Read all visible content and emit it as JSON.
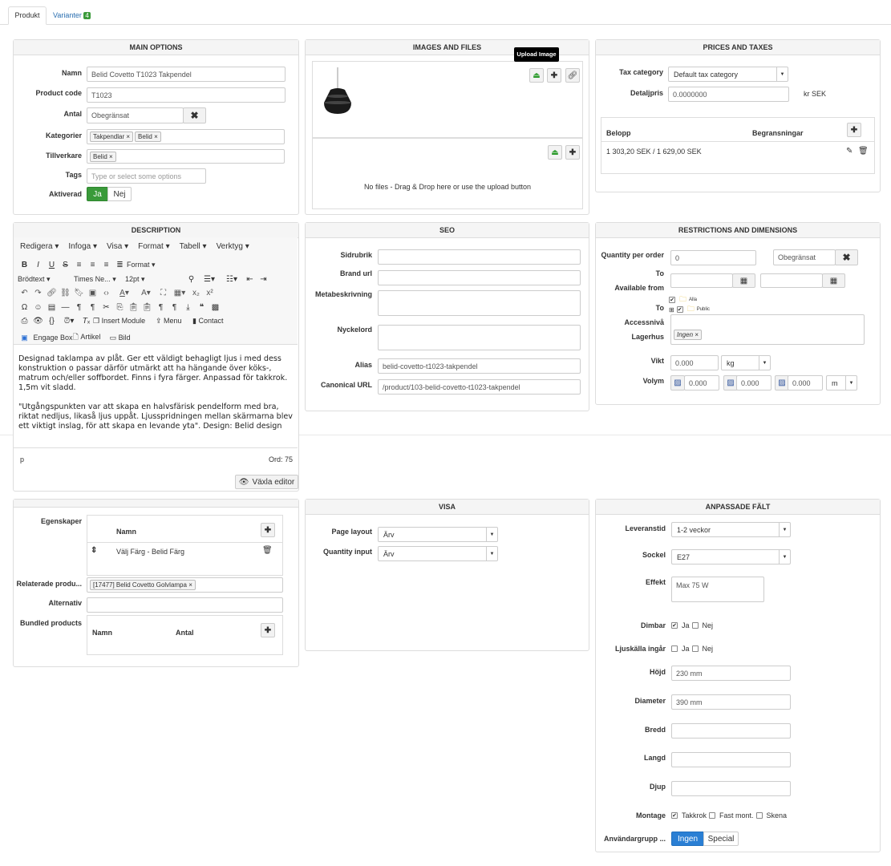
{
  "tabs": [
    {
      "label": "Produkt",
      "active": true
    },
    {
      "label": "Varianter",
      "badge": "4"
    }
  ],
  "main_options": {
    "title": "MAIN OPTIONS",
    "name_label": "Namn",
    "name_value": "Belid Covetto T1023 Takpendel",
    "code_label": "Product code",
    "code_value": "T1023",
    "antal_label": "Antal",
    "antal_value": "Obegränsat",
    "kategorier_label": "Kategorier",
    "kategorier": [
      "Takpendlar",
      "Belid"
    ],
    "tillverkare_label": "Tillverkare",
    "tillverkare": [
      "Belid"
    ],
    "tags_label": "Tags",
    "tags_placeholder": "Type or select some options",
    "aktiverad_label": "Aktiverad",
    "ja": "Ja",
    "nej": "Nej",
    "accent": "#3a9a3a"
  },
  "images": {
    "title": "IMAGES AND FILES",
    "tooltip": "Upload Image",
    "no_files": "No files - Drag & Drop here or use the upload button"
  },
  "prices": {
    "title": "PRICES AND TAXES",
    "tax_label": "Tax category",
    "tax_value": "Default tax category",
    "price_label": "Detaljpris",
    "price_value": "0.0000000",
    "currency": "kr SEK",
    "col_belopp": "Belopp",
    "col_begr": "Begransningar",
    "row": "1 303,20 SEK / 1 629,00 SEK"
  },
  "description": {
    "title": "DESCRIPTION",
    "menus": [
      "Redigera",
      "Infoga",
      "Visa",
      "Format",
      "Tabell",
      "Verktyg"
    ],
    "format_label": "Format",
    "style": "Brödtext",
    "font": "Times Ne...",
    "size": "12pt",
    "insert_module": "Insert Module",
    "menu": "Menu",
    "contact": "Contact",
    "engage_box": "Engage Box",
    "artikel": "Artikel",
    "bild": "Bild",
    "para1": "Designad taklampa av plåt. Ger ett väldigt behagligt ljus i med dess konstruktion o passar därför utmärkt att ha hängande över köks-, matrum och/eller soffbordet. Finns i fyra färger. Anpassad för takkrok. 1,5m vit sladd.",
    "para2": "\"Utgångspunkten var att skapa en halvsfärisk pendelform med bra, riktat nedljus, likaså ljus uppåt. Ljusspridningen mellan skärmarna blev ett viktigt inslag, för att skapa en levande yta\". Design: Belid design",
    "status_path": "p",
    "word_count": "Ord: 75",
    "toggle_editor": "Växla editor"
  },
  "seo": {
    "title": "SEO",
    "sidrubrik": "Sidrubrik",
    "brand_url": "Brand url",
    "meta": "Metabeskrivning",
    "nyckelord": "Nyckelord",
    "alias_label": "Alias",
    "alias_value": "belid-covetto-t1023-takpendel",
    "canonical_label": "Canonical URL",
    "canonical_value": "/product/103-belid-covetto-t1023-takpendel"
  },
  "restrictions": {
    "title": "RESTRICTIONS AND DIMENSIONS",
    "qpo_label": "Quantity per order",
    "qpo_value": "0",
    "qpo_max": "Obegränsat",
    "to1": "To",
    "available_from": "Available from",
    "tree_all": "Alla",
    "tree_public": "Public",
    "to2": "To",
    "access": "Accessnivå",
    "lagerhus": "Lagerhus",
    "lagerhus_tag": "Ingen",
    "vikt_label": "Vikt",
    "vikt_value": "0.000",
    "vikt_unit": "kg",
    "volym_label": "Volym",
    "volym_values": [
      "0.000",
      "0.000",
      "0.000"
    ],
    "volym_unit": "m"
  },
  "properties": {
    "egenskaper": "Egenskaper",
    "col_namn": "Namn",
    "row": "Välj Färg - Belid Färg",
    "related_label": "Relaterade produ...",
    "related_tag": "[17477] Belid Covetto Golvlampa",
    "alternativ": "Alternativ",
    "bundled": "Bundled products",
    "b_namn": "Namn",
    "b_antal": "Antal"
  },
  "visa": {
    "title": "VISA",
    "page_layout": "Page layout",
    "page_layout_value": "Ärv",
    "quantity_input": "Quantity input",
    "quantity_input_value": "Ärv"
  },
  "custom": {
    "title": "ANPASSADE FÄLT",
    "leveranstid": "Leveranstid",
    "leveranstid_value": "1-2 veckor",
    "sockel": "Sockel",
    "sockel_value": "E27",
    "effekt": "Effekt",
    "effekt_value": "Max 75 W",
    "dimbar": "Dimbar",
    "ja": "Ja",
    "nej": "Nej",
    "ljuskalla": "Ljuskälla ingår",
    "hojd": "Höjd",
    "hojd_value": "230 mm",
    "diameter": "Diameter",
    "diameter_value": "390 mm",
    "bredd": "Bredd",
    "langd": "Langd",
    "djup": "Djup",
    "montage": "Montage",
    "takkrok": "Takkrok",
    "fast": "Fast mont.",
    "skena": "Skena",
    "anvandargrupp": "Användargrupp ...",
    "ingen": "Ingen",
    "special": "Special",
    "accent": "#2a7fd4"
  }
}
